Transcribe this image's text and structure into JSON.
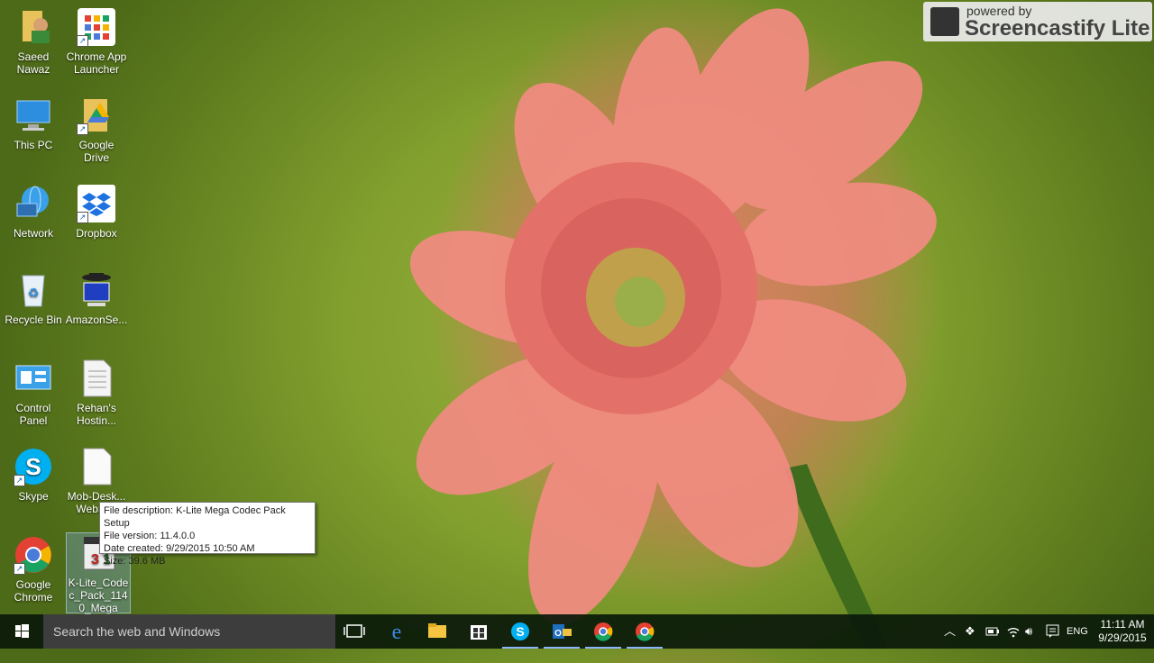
{
  "desktop": {
    "icons": [
      {
        "label": "Saeed Nawaz",
        "icon": "user-folder-icon"
      },
      {
        "label": "Chrome App Launcher",
        "icon": "app-launcher-icon"
      },
      {
        "label": "This PC",
        "icon": "computer-icon"
      },
      {
        "label": "Google Drive",
        "icon": "google-drive-icon"
      },
      {
        "label": "Network",
        "icon": "network-icon"
      },
      {
        "label": "Dropbox",
        "icon": "dropbox-icon"
      },
      {
        "label": "Recycle Bin",
        "icon": "recycle-bin-icon"
      },
      {
        "label": "AmazonSe...",
        "icon": "spy-app-icon"
      },
      {
        "label": "Control Panel",
        "icon": "control-panel-icon"
      },
      {
        "label": "Rehan's Hostin...",
        "icon": "document-icon"
      },
      {
        "label": "Skype",
        "icon": "skype-icon"
      },
      {
        "label": "Mob-Desk... WebSi...",
        "icon": "file-icon"
      },
      {
        "label": "Google Chrome",
        "icon": "chrome-icon"
      },
      {
        "label": "K-Lite_Codec_Pack_1140_Mega",
        "icon": "klite-installer-icon"
      }
    ]
  },
  "tooltip": {
    "description": "File description: K-Lite Mega Codec Pack Setup",
    "version": "File version: 11.4.0.0",
    "created": "Date created: 9/29/2015 10:50 AM",
    "size": "Size: 39.6 MB"
  },
  "watermark": {
    "small": "powered by",
    "big": "Screencastify Lite"
  },
  "taskbar": {
    "search_placeholder": "Search the web and Windows",
    "apps": [
      "task-view-icon",
      "edge-icon",
      "file-explorer-icon",
      "store-icon",
      "skype-icon",
      "outlook-icon",
      "chrome-icon",
      "chrome-icon"
    ],
    "tray": {
      "language": "ENG",
      "time": "11:11 AM",
      "date": "9/29/2015"
    }
  },
  "colors": {
    "taskbar": "#0a190a",
    "search_box": "#3d3d3d",
    "accent": "#8ab4f8"
  }
}
